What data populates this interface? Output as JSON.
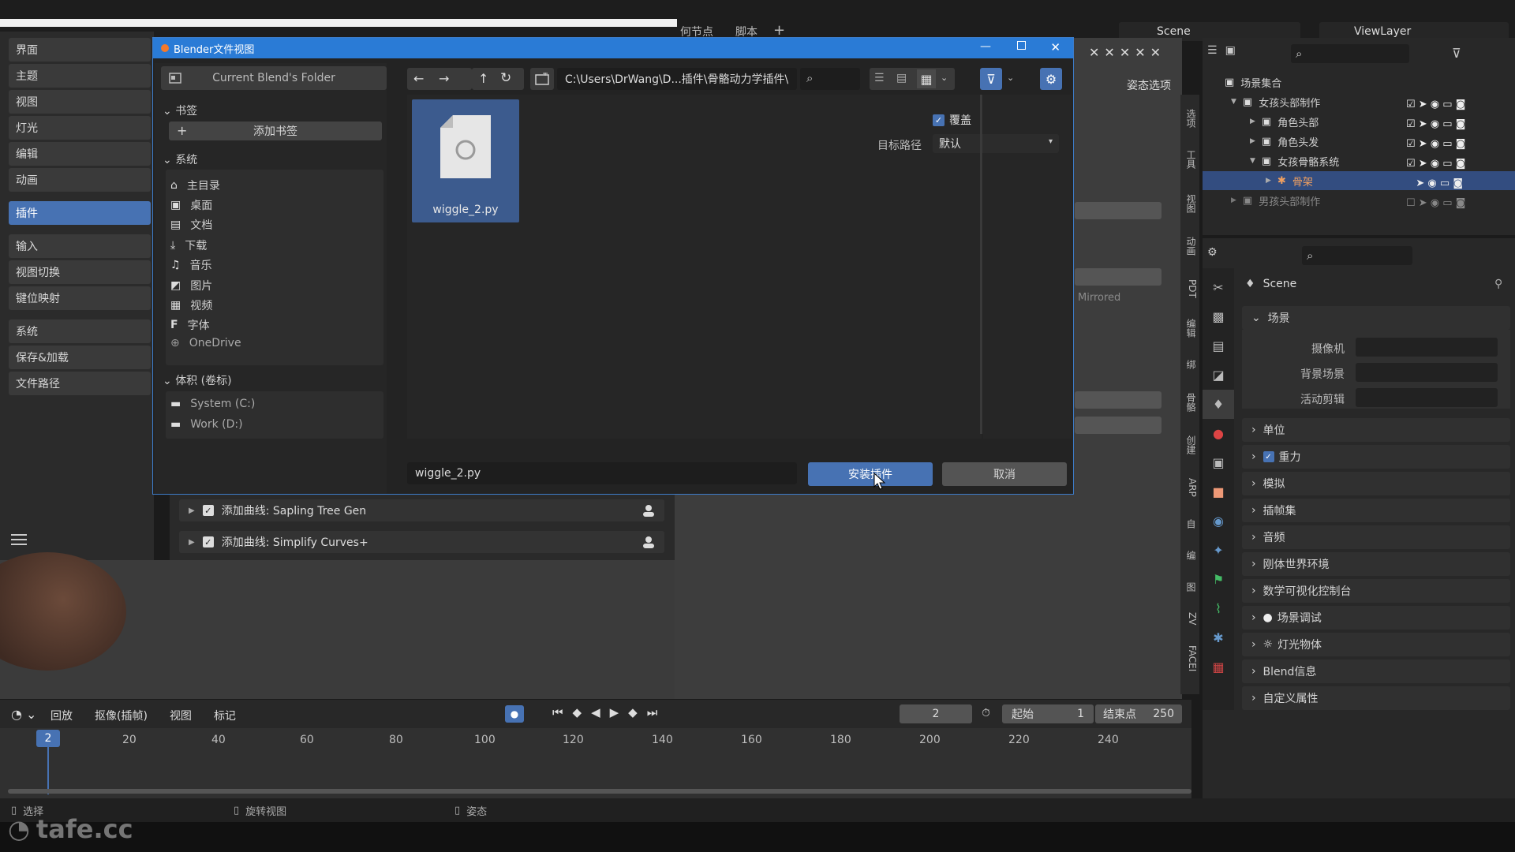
{
  "topbar": {
    "menu_left": "何节点",
    "menu_script": "脚本",
    "plus": "+",
    "scene_label": "Scene",
    "viewlayer_label": "ViewLayer"
  },
  "prefs_sidebar": {
    "items": [
      "界面",
      "主题",
      "视图",
      "灯光",
      "编辑",
      "动画",
      "插件",
      "输入",
      "视图切换",
      "键位映射",
      "系统",
      "保存&加载",
      "文件路径"
    ],
    "active": "插件"
  },
  "file_dialog": {
    "title": "Blender文件视图",
    "current_folder_button": "Current Blend's Folder",
    "path": "C:\\Users\\DrWang\\D...插件\\骨骼动力学插件\\",
    "bookmarks_header": "书签",
    "add_bookmark": "添加书签",
    "system_header": "系统",
    "system_items": [
      {
        "label": "主目录",
        "icon": "home-icon"
      },
      {
        "label": "桌面",
        "icon": "desktop-icon"
      },
      {
        "label": "文档",
        "icon": "documents-icon"
      },
      {
        "label": "下载",
        "icon": "download-icon"
      },
      {
        "label": "音乐",
        "icon": "music-icon"
      },
      {
        "label": "图片",
        "icon": "image-icon"
      },
      {
        "label": "视频",
        "icon": "video-icon"
      },
      {
        "label": "字体",
        "icon": "font-icon"
      },
      {
        "label": "OneDrive",
        "icon": "globe-icon"
      }
    ],
    "volumes_header": "体积 (卷标)",
    "volume_items": [
      {
        "label": "System (C:)"
      },
      {
        "label": "Work (D:)"
      }
    ],
    "file_item": "wiggle_2.py",
    "overwrite_label": "覆盖",
    "target_path_label": "目标路径",
    "target_path_value": "默认",
    "filename_value": "wiggle_2.py",
    "install_button": "安装插件",
    "cancel_button": "取消"
  },
  "addon_list": [
    {
      "label": "添加曲线: Sapling Tree Gen"
    },
    {
      "label": "添加曲线: Simplify Curves+"
    }
  ],
  "viewport_header": {
    "pose_options": "姿态选项",
    "mirrored": "Mirrored"
  },
  "side_tabs": [
    "选项",
    "工具",
    "视图",
    "动画",
    "PDT",
    "编辑",
    "绑",
    "骨骼",
    "创建",
    "ARP",
    "自",
    "编",
    "图",
    "ZV",
    "FACEI"
  ],
  "outliner": {
    "root": "场景集合",
    "rows": [
      {
        "label": "女孩头部制作",
        "indent": 0
      },
      {
        "label": "角色头部",
        "indent": 1
      },
      {
        "label": "角色头发",
        "indent": 1
      },
      {
        "label": "女孩骨骼系统",
        "indent": 0
      },
      {
        "label": "骨架",
        "indent": 2,
        "selected": true
      },
      {
        "label": "男孩头部制作",
        "indent": 0,
        "dim": true
      }
    ]
  },
  "properties": {
    "scene_name": "Scene",
    "scene_section": "场景",
    "camera_label": "摄像机",
    "background_label": "背景场景",
    "active_clip_label": "活动剪辑",
    "sections": [
      "单位",
      "重力",
      "模拟",
      "插帧集",
      "音频",
      "刚体世界环境",
      "数学可视化控制台",
      "场景调试",
      "灯光物体",
      "Blend信息",
      "自定义属性"
    ]
  },
  "timeline": {
    "menus": [
      "回放",
      "抠像(插帧)",
      "视图",
      "标记"
    ],
    "current_frame": "2",
    "start_label": "起始",
    "start_value": "1",
    "end_label": "结束点",
    "end_value": "250",
    "ticks": [
      "20",
      "40",
      "60",
      "80",
      "100",
      "120",
      "140",
      "160",
      "180",
      "200",
      "220",
      "240"
    ],
    "playhead": "2"
  },
  "statusbar": {
    "select": "选择",
    "rotate_view": "旋转视图",
    "pose": "姿态"
  },
  "watermark": "tafe.cc",
  "colors": {
    "accent": "#4772b3",
    "title_bar": "#2a7bd6",
    "selected_row": "#334d80"
  }
}
